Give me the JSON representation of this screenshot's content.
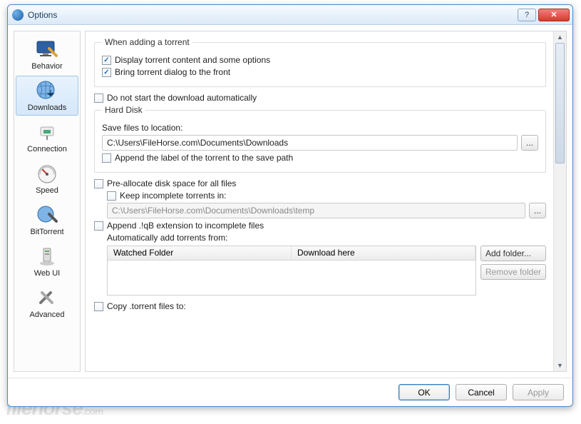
{
  "window": {
    "title": "Options"
  },
  "sidebar": {
    "items": [
      {
        "label": "Behavior"
      },
      {
        "label": "Downloads"
      },
      {
        "label": "Connection"
      },
      {
        "label": "Speed"
      },
      {
        "label": "BitTorrent"
      },
      {
        "label": "Web UI"
      },
      {
        "label": "Advanced"
      }
    ],
    "selected": 1
  },
  "groups": {
    "addingTorrent": {
      "legend": "When adding a torrent",
      "displayContent": {
        "checked": true,
        "label": "Display torrent content and some options"
      },
      "bringToFront": {
        "checked": true,
        "label": "Bring torrent dialog to the front"
      }
    },
    "noAutoStart": {
      "checked": false,
      "label": "Do not start the download automatically"
    },
    "hardDisk": {
      "legend": "Hard Disk",
      "saveLocationLabel": "Save files to location:",
      "saveLocation": "C:\\Users\\FileHorse.com\\Documents\\Downloads",
      "browseBtn": "...",
      "appendLabel": {
        "checked": false,
        "label": "Append the label of the torrent to the save path"
      }
    },
    "preallocate": {
      "checked": false,
      "label": "Pre-allocate disk space for all files"
    },
    "keepIncomplete": {
      "checked": false,
      "label": "Keep incomplete torrents in:",
      "path": "C:\\Users\\FileHorse.com\\Documents\\Downloads\\temp",
      "browseBtn": "..."
    },
    "appendQB": {
      "checked": false,
      "label": "Append .!qB extension to incomplete files"
    },
    "autoAdd": {
      "label": "Automatically add torrents from:",
      "columns": [
        "Watched Folder",
        "Download here"
      ],
      "addFolderBtn": "Add folder...",
      "removeFolderBtn": "Remove folder"
    },
    "copyTorrent": {
      "checked": false,
      "label": "Copy .torrent files to:"
    }
  },
  "footer": {
    "ok": "OK",
    "cancel": "Cancel",
    "apply": "Apply"
  },
  "watermark": {
    "main": "filehorse",
    "suffix": ".com"
  }
}
